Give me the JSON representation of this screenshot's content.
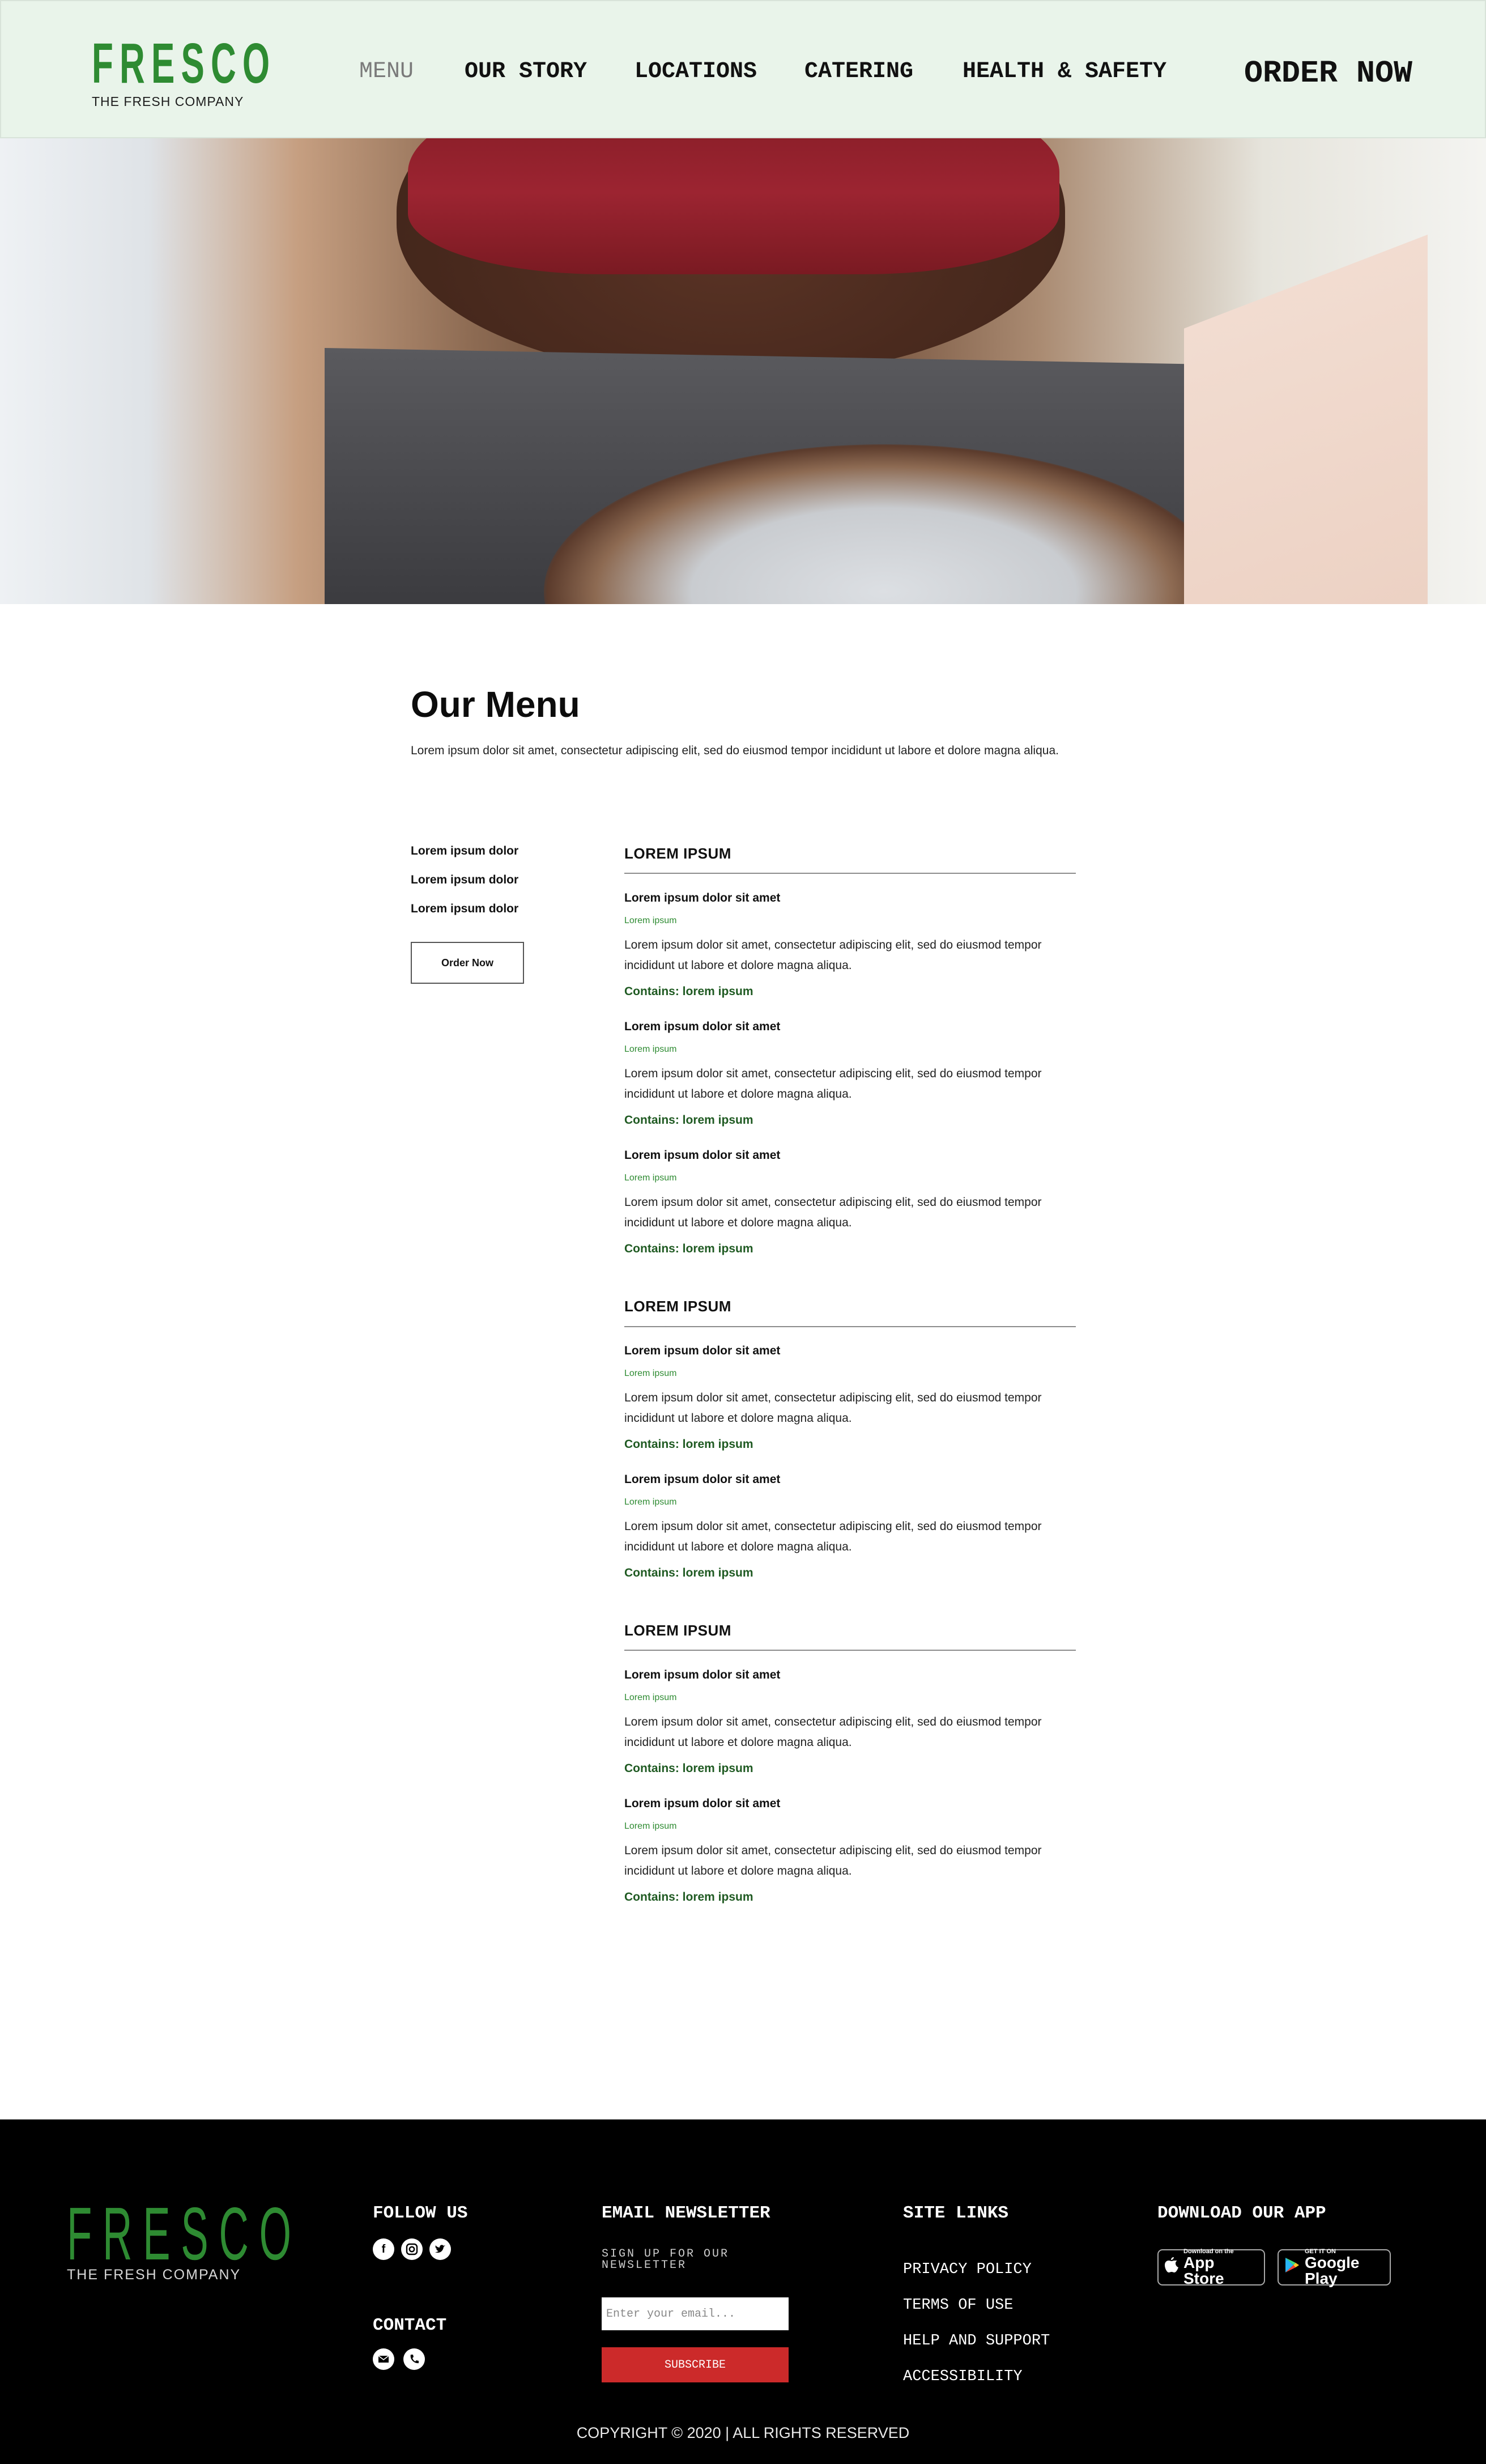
{
  "brand": {
    "name": "FRESCO",
    "tagline": "THE FRESH COMPANY",
    "accent_color": "#2e8b32",
    "header_bg": "#e9f4ea"
  },
  "nav": {
    "items": [
      {
        "label": "MENU",
        "active": true
      },
      {
        "label": "OUR STORY",
        "active": false
      },
      {
        "label": "LOCATIONS",
        "active": false
      },
      {
        "label": "CATERING",
        "active": false
      },
      {
        "label": "HEALTH & SAFETY",
        "active": false
      }
    ],
    "order_now": "ORDER NOW"
  },
  "hero": {
    "image_icon": "hero-photo"
  },
  "menu_page": {
    "title": "Our Menu",
    "intro": "Lorem ipsum dolor sit amet, consectetur adipiscing elit, sed do eiusmod tempor incididunt ut  labore et dolore magna aliqua.",
    "sidebar": {
      "categories": [
        "Lorem ipsum dolor",
        "Lorem ipsum dolor",
        "Lorem ipsum dolor"
      ],
      "order_button": "Order Now"
    },
    "sections": [
      {
        "title": "LOREM IPSUM",
        "items": [
          {
            "name": "Lorem ipsum dolor sit amet",
            "sub": "Lorem ipsum",
            "desc": "Lorem ipsum dolor sit amet, consectetur adipiscing elit, sed do eiusmod tempor incididunt ut labore et dolore magna aliqua.",
            "contains": "Contains: lorem ipsum"
          },
          {
            "name": "Lorem ipsum dolor sit amet",
            "sub": "Lorem ipsum",
            "desc": "Lorem ipsum dolor sit amet, consectetur adipiscing elit, sed do eiusmod tempor incididunt ut labore et dolore magna aliqua.",
            "contains": "Contains: lorem ipsum"
          },
          {
            "name": "Lorem ipsum dolor sit amet",
            "sub": "Lorem ipsum",
            "desc": "Lorem ipsum dolor sit amet, consectetur adipiscing elit, sed do eiusmod tempor incididunt ut labore et dolore magna aliqua.",
            "contains": "Contains: lorem ipsum"
          }
        ]
      },
      {
        "title": "LOREM IPSUM",
        "items": [
          {
            "name": "Lorem ipsum dolor sit amet",
            "sub": "Lorem ipsum",
            "desc": "Lorem ipsum dolor sit amet, consectetur adipiscing elit, sed do eiusmod tempor incididunt ut labore et dolore magna aliqua.",
            "contains": "Contains: lorem ipsum"
          },
          {
            "name": "Lorem ipsum dolor sit amet",
            "sub": "Lorem ipsum",
            "desc": "Lorem ipsum dolor sit amet, consectetur adipiscing elit, sed do eiusmod tempor incididunt ut labore et dolore magna aliqua.",
            "contains": "Contains: lorem ipsum"
          }
        ]
      },
      {
        "title": "LOREM IPSUM",
        "items": [
          {
            "name": "Lorem ipsum dolor sit amet",
            "sub": "Lorem ipsum",
            "desc": "Lorem ipsum dolor sit amet, consectetur adipiscing elit, sed do eiusmod tempor incididunt ut labore et dolore magna aliqua.",
            "contains": "Contains: lorem ipsum"
          },
          {
            "name": "Lorem ipsum dolor sit amet",
            "sub": "Lorem ipsum",
            "desc": "Lorem ipsum dolor sit amet, consectetur adipiscing elit, sed do eiusmod tempor incididunt ut labore et dolore magna aliqua.",
            "contains": "Contains: lorem ipsum"
          }
        ]
      }
    ]
  },
  "footer": {
    "follow_us": "FOLLOW US",
    "social_icons": [
      "facebook-icon",
      "instagram-icon",
      "twitter-icon"
    ],
    "contact": "CONTACT",
    "contact_icons": [
      "email-icon",
      "phone-icon"
    ],
    "newsletter": {
      "heading": "EMAIL NEWSLETTER",
      "subheading": "SIGN UP FOR OUR NEWSLETTER",
      "placeholder": "Enter your email...",
      "button": "SUBSCRIBE",
      "button_color": "#cc2a2a"
    },
    "site_links": {
      "heading": "SITE LINKS",
      "links": [
        "PRIVACY POLICY",
        "TERMS OF USE",
        "HELP AND SUPPORT",
        "ACCESSIBILITY"
      ]
    },
    "app": {
      "heading": "DOWNLOAD OUR APP",
      "app_store_small": "Download on the",
      "app_store_big": "App Store",
      "google_play_small": "GET IT ON",
      "google_play_big": "Google Play"
    },
    "copyright": "COPYRIGHT © 2020 | ALL RIGHTS RESERVED"
  }
}
